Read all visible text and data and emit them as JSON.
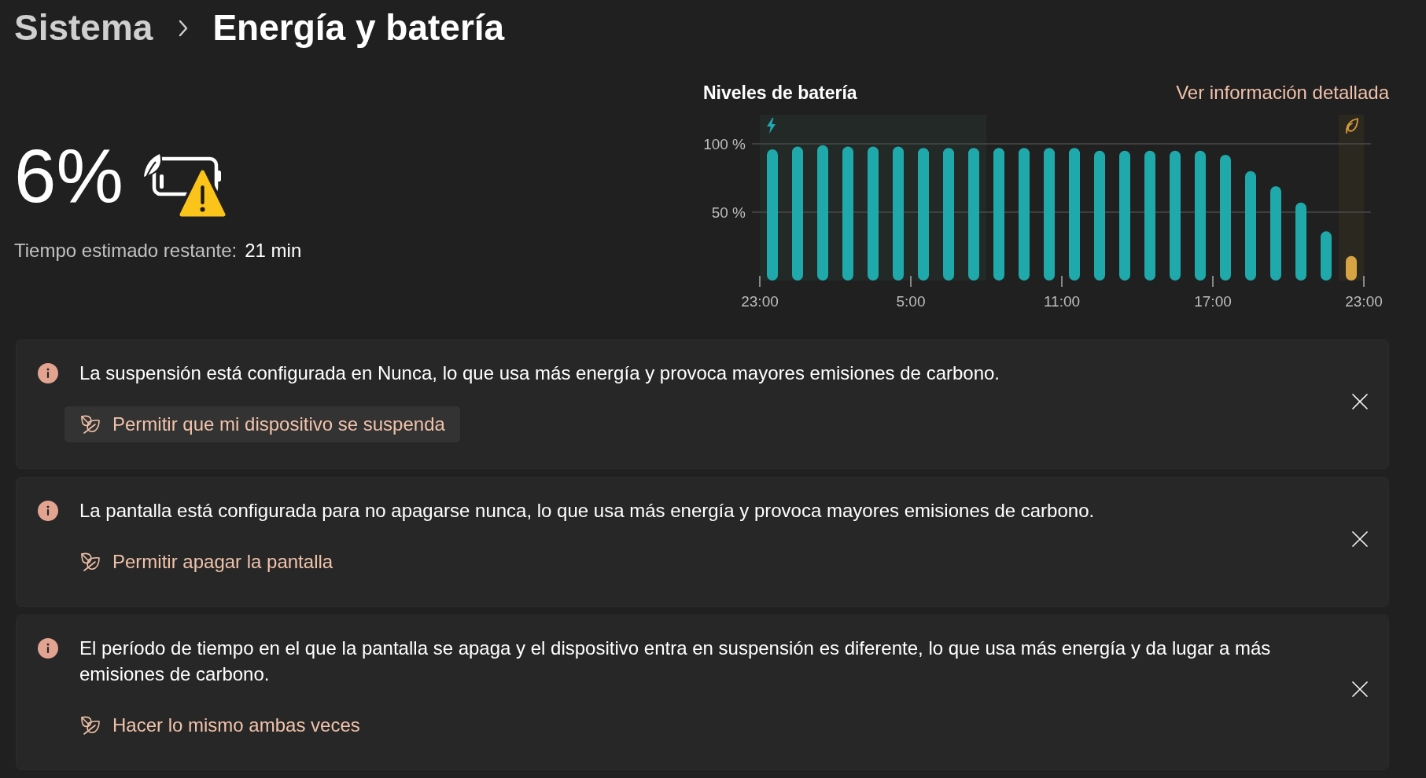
{
  "breadcrumb": {
    "parent": "Sistema",
    "title": "Energía y batería"
  },
  "battery": {
    "percent": "6%",
    "warning": true,
    "time_label": "Tiempo estimado restante:",
    "time_value": "21 min"
  },
  "battery_levels": {
    "title": "Niveles de batería",
    "link": "Ver información detallada",
    "chart_data": {
      "type": "bar",
      "categories": [
        "23:00",
        null,
        null,
        null,
        null,
        null,
        "5:00",
        null,
        null,
        null,
        null,
        null,
        "11:00",
        null,
        null,
        null,
        null,
        null,
        "17:00",
        null,
        null,
        null,
        null,
        null,
        "23:00"
      ],
      "series": [
        {
          "color": "#1fa9ab",
          "values": [
            96,
            98,
            99,
            98,
            98,
            98,
            97,
            97,
            97,
            97,
            97,
            97,
            97,
            95,
            95,
            95,
            95,
            95,
            92,
            80,
            69,
            57,
            36,
            null,
            null
          ]
        },
        {
          "color": "#d8a443",
          "values": [
            null,
            null,
            null,
            null,
            null,
            null,
            null,
            null,
            null,
            null,
            null,
            null,
            null,
            null,
            null,
            null,
            null,
            null,
            null,
            null,
            null,
            null,
            null,
            18,
            null
          ]
        }
      ],
      "ylim": [
        0,
        100
      ],
      "yticks": [
        {
          "value": 50,
          "label": "50 %"
        },
        {
          "value": 100,
          "label": "100 %"
        }
      ]
    }
  },
  "recommendations": [
    {
      "message": "La suspensión está configurada en Nunca, lo que usa más energía y provoca mayores emisiones de carbono.",
      "action": "Permitir que mi dispositivo se suspenda",
      "hovered": true
    },
    {
      "message": "La pantalla está configurada para no apagarse nunca, lo que usa más energía y provoca mayores emisiones de carbono.",
      "action": "Permitir apagar la pantalla",
      "hovered": false
    },
    {
      "message": "El período de tiempo en el que la pantalla se apaga y el dispositivo entra en suspensión es diferente, lo que usa más energía y da lugar a más emisiones de carbono.",
      "action": "Hacer lo mismo ambas veces",
      "hovered": false
    }
  ]
}
